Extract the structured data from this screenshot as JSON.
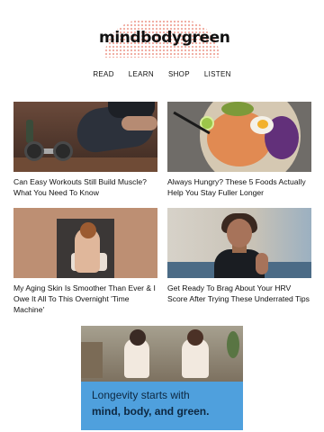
{
  "header": {
    "logo_text": "mindbodygreen"
  },
  "nav": {
    "items": [
      "READ",
      "LEARN",
      "SHOP",
      "LISTEN"
    ]
  },
  "articles": [
    {
      "title": "Can Easy Workouts Still Build Muscle? What You Need To Know"
    },
    {
      "title": "Always Hungry? These 5 Foods Actually Help You Stay Fuller Longer"
    },
    {
      "title": "My Aging Skin Is Smoother Than Ever & I Owe It All To This Overnight 'Time Machine'"
    },
    {
      "title": "Get Ready To Brag About Your HRV Score After Trying These Underrated Tips"
    }
  ],
  "ad": {
    "line1": "Longevity starts with",
    "line2": "mind, body, and green."
  }
}
